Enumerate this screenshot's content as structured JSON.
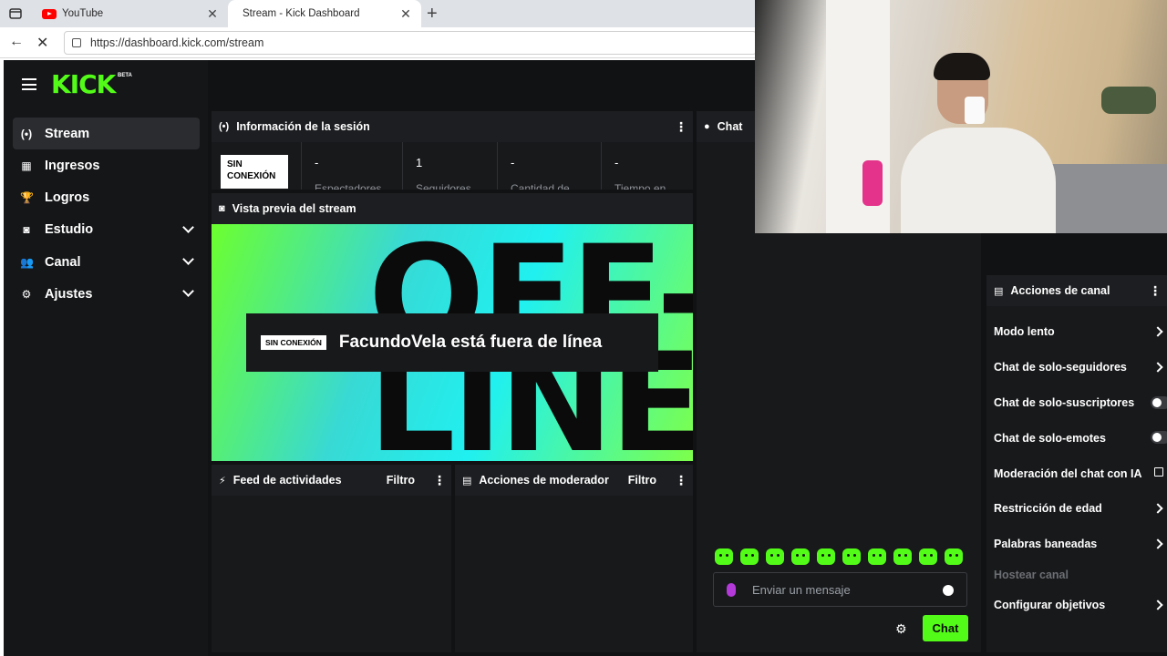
{
  "browser": {
    "tabs": [
      {
        "label": "YouTube"
      },
      {
        "label": "Stream - Kick Dashboard"
      }
    ],
    "url": "https://dashboard.kick.com/stream"
  },
  "logo": {
    "text": "KICK",
    "badge": "BETA"
  },
  "sidebar": {
    "items": [
      {
        "label": "Stream",
        "icon": "broadcast-icon",
        "glyph": "(•)"
      },
      {
        "label": "Ingresos",
        "icon": "chart-icon",
        "glyph": "▦"
      },
      {
        "label": "Logros",
        "icon": "trophy-icon",
        "glyph": "🏆"
      },
      {
        "label": "Estudio",
        "icon": "studio-icon",
        "glyph": "◙"
      },
      {
        "label": "Canal",
        "icon": "users-icon",
        "glyph": "👥"
      },
      {
        "label": "Ajustes",
        "icon": "gear-icon",
        "glyph": "⚙"
      }
    ]
  },
  "session": {
    "title": "Información de la sesión",
    "status": "SIN CONEXIÓN",
    "stats": [
      {
        "value": "-",
        "label": "Espectadores"
      },
      {
        "value": "1",
        "label": "Seguidores"
      },
      {
        "value": "-",
        "label": "Cantidad de"
      },
      {
        "value": "-",
        "label": "Tiempo en"
      }
    ]
  },
  "preview": {
    "title": "Vista previa del stream",
    "background_text": "OFF-\nLINE",
    "badge": "SIN CONEXIÓN",
    "message": "FacundoVela está fuera de línea"
  },
  "activity": {
    "title": "Feed de actividades",
    "filter": "Filtro"
  },
  "moderator": {
    "title": "Acciones de moderador",
    "filter": "Filtro"
  },
  "chat": {
    "title": "Chat",
    "placeholder": "Enviar un mensaje",
    "send_label": "Chat",
    "emote_count": 10
  },
  "channel_actions": {
    "title": "Acciones de canal",
    "items": [
      {
        "label": "Modo lento",
        "control": "arrow"
      },
      {
        "label": "Chat de solo-seguidores",
        "control": "arrow"
      },
      {
        "label": "Chat de solo-suscriptores",
        "control": "toggle"
      },
      {
        "label": "Chat de solo-emotes",
        "control": "toggle"
      },
      {
        "label": "Moderación del chat con IA",
        "control": "external"
      },
      {
        "label": "Restricción de edad",
        "control": "arrow"
      },
      {
        "label": "Palabras baneadas",
        "control": "arrow"
      },
      {
        "label": "Hostear canal",
        "control": "disabled"
      },
      {
        "label": "Configurar objetivos",
        "control": "arrow"
      }
    ]
  },
  "colors": {
    "accent": "#53fc18",
    "background": "#111214",
    "panel": "#18191b"
  }
}
